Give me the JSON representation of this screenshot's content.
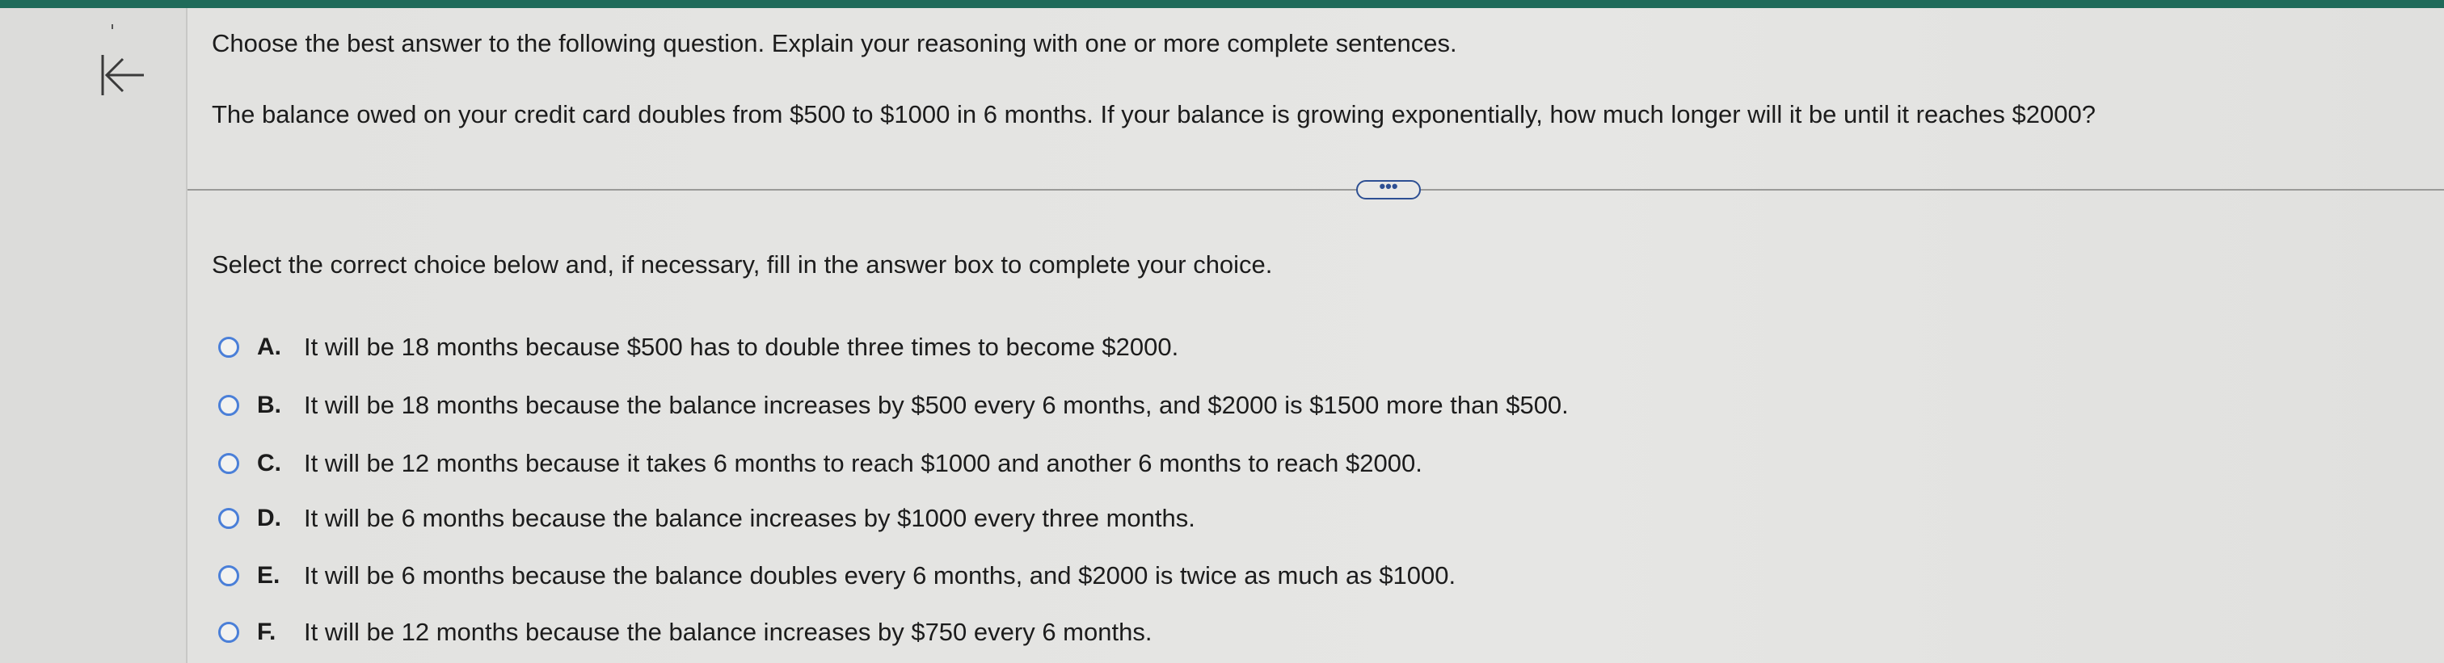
{
  "instruction": "Choose the best answer to the following question. Explain your reasoning with one or more complete sentences.",
  "question": "The balance owed on your credit card doubles from $500 to $1000 in 6 months. If your balance is growing exponentially, how much longer will it be until it reaches $2000?",
  "more_button_label": "•••",
  "select_prompt": "Select the correct choice below and, if necessary, fill in the answer box to complete your choice.",
  "collapse_icon": "collapse-left-icon",
  "choices": [
    {
      "letter": "A.",
      "text": "It will be 18 months because $500 has to double three times to become $2000."
    },
    {
      "letter": "B.",
      "text": "It will be 18 months because the balance increases by $500 every 6 months, and $2000 is $1500 more than $500."
    },
    {
      "letter": "C.",
      "text": "It will be 12 months because it takes 6 months to reach $1000 and another 6 months to reach $2000."
    },
    {
      "letter": "D.",
      "text": "It will be 6 months because the balance increases by $1000 every three months."
    },
    {
      "letter": "E.",
      "text": "It will be 6 months because the balance doubles every 6 months, and $2000 is twice as much as $1000."
    },
    {
      "letter": "F.",
      "text": "It will be 12 months because the balance increases by $750 every 6 months."
    }
  ]
}
